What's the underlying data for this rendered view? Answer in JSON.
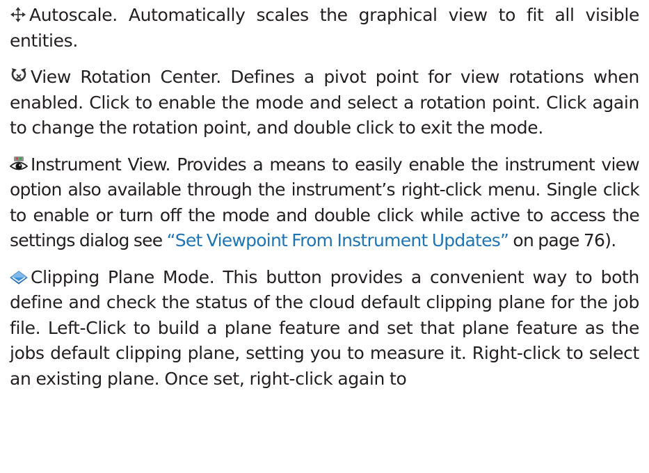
{
  "paragraphs": [
    {
      "icon": "autoscale-icon",
      "text": "Autoscale. Automatically scales the graphical view to fit all visible entities."
    },
    {
      "icon": "view-rotation-center-icon",
      "text": "View Rotation Center. Defines a pivot point for view rotations when enabled. Click to enable the mode and select a rotation point. Click again to change the rotation point, and double click to exit the mode."
    },
    {
      "icon": "instrument-view-icon",
      "text_before": "Instrument View. Provides a means to easily enable the instrument view option also available through the instrument’s right-click menu. Single click to enable or turn off the mode and double click while active to access the settings dialog see ",
      "link": "“Set Viewpoint From Instrument Updates”",
      "text_after": " on page 76)."
    },
    {
      "icon": "clipping-plane-icon",
      "text": "Clipping Plane Mode. This button provides a convenient way to both define and check the status of the cloud default clipping plane for the job file. Left-Click to build a plane feature and set that plane feature as the jobs default clipping plane, setting you to measure it. Right-click to select an existing plane. Once set, right-click again to"
    }
  ],
  "colors": {
    "text": "#231f20",
    "link": "#1f74b4"
  }
}
